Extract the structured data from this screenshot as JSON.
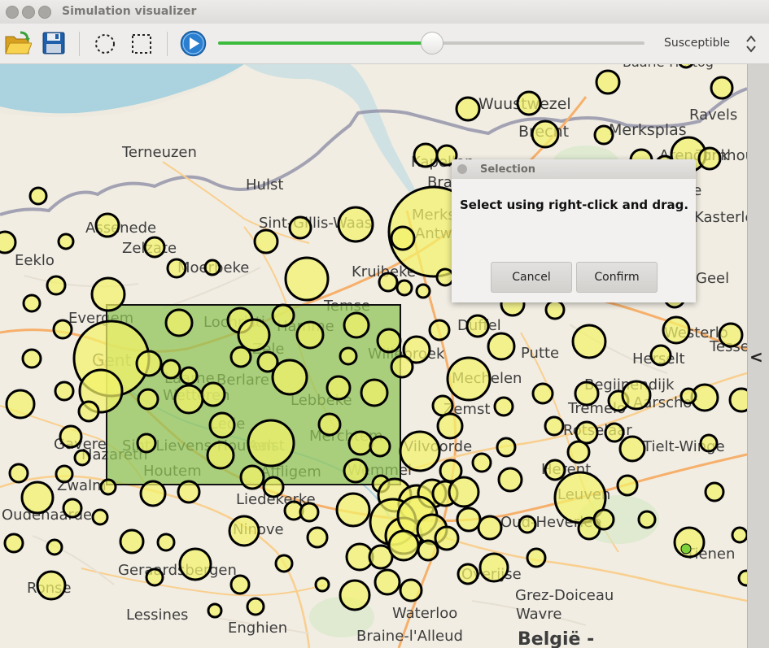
{
  "window": {
    "title": "Simulation visualizer"
  },
  "toolbar": {
    "open_icon": "folder-open-icon",
    "save_icon": "save-disk-icon",
    "circle_select_icon": "circle-selection-icon",
    "rect_select_icon": "rectangle-selection-icon",
    "play_icon": "play-icon",
    "progress_fraction": 0.5,
    "slider_color": "#3dbb3d",
    "state_select": {
      "selected": "Susceptible"
    }
  },
  "map": {
    "labels": [
      "Baarle-Hertog",
      "Wuustwezel",
      "Brecht",
      "Merksplas",
      "Ravels",
      "Terneuzen",
      "Hulst",
      "Kapellen",
      "Brasschaat",
      "Arendonk",
      "Sint-Gillis-Waas",
      "Merksem",
      "Antwerpen",
      "Turnhout",
      "Assenede",
      "Zelzate",
      "Eeklo",
      "Moerbeke",
      "Kruibeke",
      "Beerse",
      "Kasterlee",
      "Geel",
      "Evergem",
      "Temse",
      "Duffel",
      "Westerlo",
      "Tessenderlo",
      "Gent",
      "Lochristi",
      "Hamme",
      "Zele",
      "Willebroek",
      "Putte",
      "Herselt",
      "Laarne",
      "Berlare",
      "Wetteren",
      "Lebbeke",
      "Mechelen",
      "Begijnendijk",
      "Aarschot",
      "Nazareth",
      "Lede",
      "Merchtem",
      "Zemst",
      "Tremelo",
      "Gavere",
      "Sint-Lievens-Houtem",
      "Aalst",
      "Affligem",
      "Wemmel",
      "Vilvoorde",
      "Rotselaar",
      "Tielt-Winge",
      "Zwalm",
      "Houtem",
      "Herent",
      "Leuven",
      "Oudenaarde",
      "Liedekerke",
      "Ninove",
      "Oud-Heverlee",
      "Tienen",
      "Geraardsbergen",
      "Overijse",
      "Ronse",
      "Lessines",
      "Enghien",
      "Grez-Doiceau",
      "Wavre",
      "Waterloo",
      "Braine-l'Alleud",
      "België -"
    ]
  },
  "selection": {
    "fill": "#8fc454"
  },
  "dialog": {
    "title": "Selection",
    "message": "Select using right-click and drag.",
    "cancel_label": "Cancel",
    "confirm_label": "Confirm"
  },
  "side_panel": {
    "toggle_label": "<"
  }
}
